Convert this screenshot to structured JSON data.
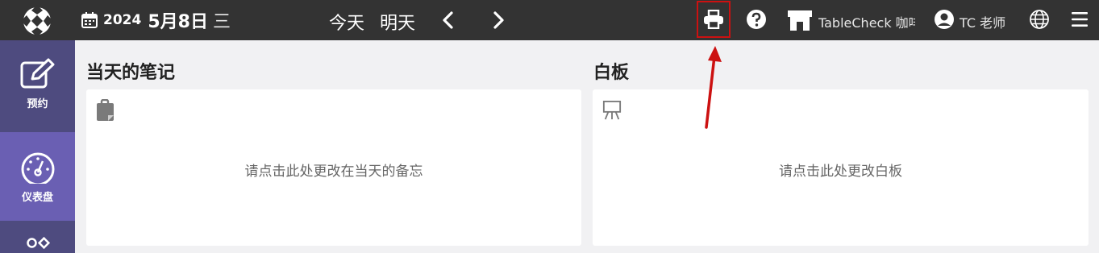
{
  "header": {
    "date_year": "2024",
    "date_month_day": "5月8日",
    "date_weekday": "三",
    "nav_today": "今天",
    "nav_tomorrow": "明天",
    "shop_name": "TableCheck 咖啡",
    "user_name": "TC 老师"
  },
  "sidebar": {
    "items": [
      {
        "label": "预约",
        "icon": "edit-icon"
      },
      {
        "label": "仪表盘",
        "icon": "dashboard-gauge-icon"
      },
      {
        "label": "",
        "icon": "shapes-icon"
      }
    ]
  },
  "notes": {
    "title": "当天的笔记",
    "placeholder": "请点击此处更改在当天的备忘",
    "icon": "clipboard-icon"
  },
  "whiteboard": {
    "title": "白板",
    "placeholder": "请点击此处更改白板",
    "icon": "easel-icon"
  },
  "colors": {
    "topbar": "#333333",
    "sidebar": "#4e4b7f",
    "sidebar_active": "#6a5fb3",
    "highlight": "#cc1111",
    "background": "#f1f1f3"
  }
}
